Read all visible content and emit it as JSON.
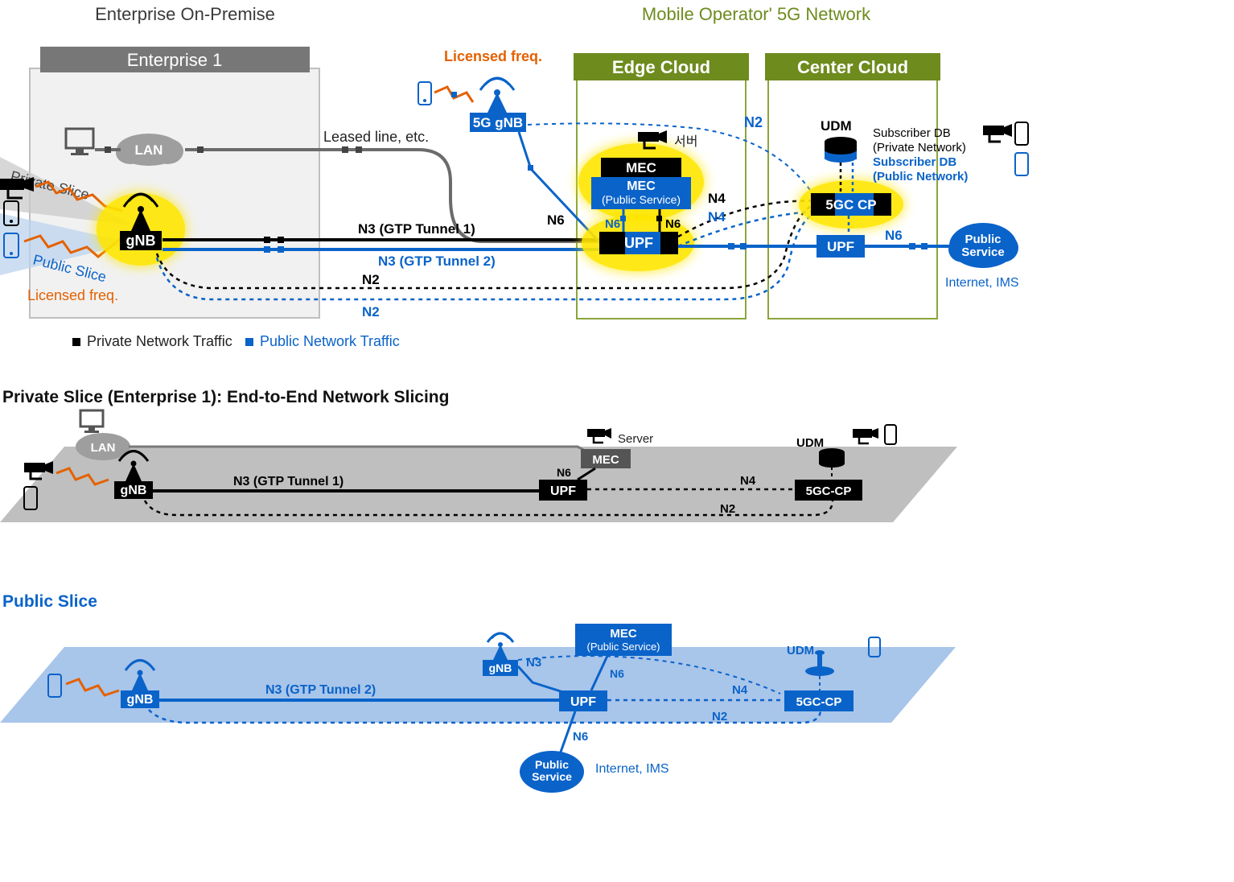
{
  "headers": {
    "enterprise": "Enterprise On-Premise",
    "operator": "Mobile Operator' 5G Network",
    "enterprise1": "Enterprise 1",
    "edgeCloud": "Edge Cloud",
    "centerCloud": "Center Cloud"
  },
  "top": {
    "lan": "LAN",
    "gnb": "gNB",
    "gnb2": "5G gNB",
    "licensedFreqTop": "Licensed freq.",
    "licensedFreqLeft": "Licensed freq.",
    "privateSlice": "Private Slice",
    "publicSlice": "Public Slice",
    "leasedLine": "Leased line, etc.",
    "n3t1": "N3 (GTP Tunnel 1)",
    "n3t2": "N3 (GTP Tunnel 2)",
    "n2a": "N2",
    "n2b": "N2",
    "n2c": "N2",
    "mec": "MEC",
    "mecPublic1": "MEC",
    "mecPublic2": "(Public Service)",
    "upf1": "UPF",
    "n6a": "N6",
    "n6b": "N6",
    "n6c": "N6",
    "n6d": "N6",
    "n4a": "N4",
    "n4b": "N4",
    "server": "서버",
    "udm": "UDM",
    "subDbPriv": "Subscriber DB",
    "subDbPriv2": "(Private Network)",
    "subDbPub": "Subscriber DB",
    "subDbPub2": "(Public Network)",
    "fgccp": "5GC CP",
    "upf2": "UPF",
    "publicService1": "Public",
    "publicService2": "Service",
    "internetIms": "Internet, IMS"
  },
  "legend": {
    "private": "Private Network Traffic",
    "public": "Public Network Traffic"
  },
  "privateSlice": {
    "title": "Private Slice (Enterprise 1): End-to-End Network Slicing",
    "lan": "LAN",
    "gnb": "gNB",
    "n3t1": "N3 (GTP Tunnel 1)",
    "upf": "UPF",
    "n6": "N6",
    "mec": "MEC",
    "server": "Server",
    "n4": "N4",
    "n2": "N2",
    "fgccp": "5GC-CP",
    "udm": "UDM"
  },
  "publicSlice": {
    "title": "Public Slice",
    "gnb": "gNB",
    "gnb2": "gNB",
    "n3t2": "N3 (GTP Tunnel 2)",
    "n3": "N3",
    "upf": "UPF",
    "n6a": "N6",
    "n6b": "N6",
    "mec1": "MEC",
    "mec2": "(Public Service)",
    "publicService1": "Public",
    "publicService2": "Service",
    "internetIms": "Internet, IMS",
    "n4": "N4",
    "n2": "N2",
    "fgccp": "5GC-CP",
    "udm": "UDM"
  },
  "colors": {
    "blue": "#0a63c9",
    "olive": "#6e8b1e",
    "orange": "#e46100",
    "yellowGlow": "#ffe600",
    "darkGray": "#555555",
    "lightGray": "#bfbfbf"
  }
}
